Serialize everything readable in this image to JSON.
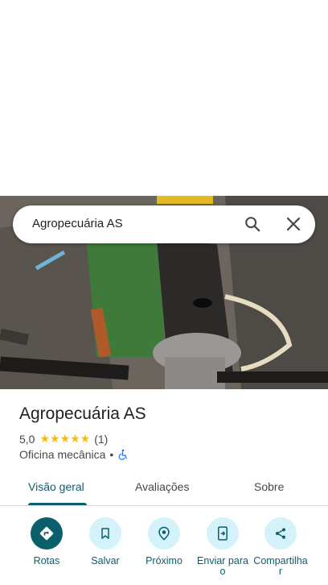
{
  "search": {
    "text": "Agropecuária AS"
  },
  "place": {
    "title": "Agropecuária AS",
    "rating": "5,0",
    "stars": "★★★★★",
    "review_count": "(1)",
    "category": "Oficina mecânica",
    "separator": "•"
  },
  "tabs": [
    {
      "label": "Visão geral",
      "active": true
    },
    {
      "label": "Avaliações",
      "active": false
    },
    {
      "label": "Sobre",
      "active": false
    }
  ],
  "actions": [
    {
      "label": "Rotas",
      "icon": "directions-icon"
    },
    {
      "label": "Salvar",
      "icon": "bookmark-icon"
    },
    {
      "label": "Próximo",
      "icon": "nearby-icon"
    },
    {
      "label": "Enviar para o",
      "icon": "send-to-phone-icon"
    },
    {
      "label": "Compartilha r",
      "icon": "share-icon"
    }
  ],
  "colors": {
    "accent": "#0b5e6b",
    "action_bg": "#d3f2fa",
    "star": "#fbbc04"
  }
}
